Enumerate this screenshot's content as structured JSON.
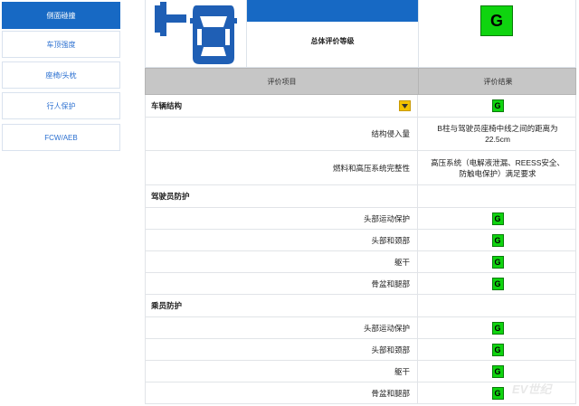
{
  "sidebar": {
    "items": [
      {
        "label": "侧面碰撞",
        "active": true
      },
      {
        "label": "车顶强度",
        "active": false
      },
      {
        "label": "座椅/头枕",
        "active": false
      },
      {
        "label": "行人保护",
        "active": false
      },
      {
        "label": "FCW/AEB",
        "active": false
      }
    ]
  },
  "hero": {
    "overall_label": "总体评价等级",
    "overall_rating": "G"
  },
  "table": {
    "header_item": "评价项目",
    "header_result": "评价结果"
  },
  "sections": {
    "vehicle": {
      "title": "车辆结构",
      "rating": "G",
      "rows": [
        {
          "label": "结构侵入量",
          "result": "B柱与驾驶员座椅中线之间的距离为22.5cm"
        },
        {
          "label": "燃料和高压系统完整性",
          "result": "高压系统（电解液泄漏、REESS安全、防触电保护）满足要求"
        }
      ]
    },
    "driver": {
      "title": "驾驶员防护",
      "rows": [
        {
          "label": "头部运动保护",
          "rating": "G"
        },
        {
          "label": "头部和颈部",
          "rating": "G"
        },
        {
          "label": "躯干",
          "rating": "G"
        },
        {
          "label": "骨盆和腿部",
          "rating": "G"
        }
      ]
    },
    "passenger": {
      "title": "乘员防护",
      "rows": [
        {
          "label": "头部运动保护",
          "rating": "G"
        },
        {
          "label": "头部和颈部",
          "rating": "G"
        },
        {
          "label": "躯干",
          "rating": "G"
        },
        {
          "label": "骨盆和腿部",
          "rating": "G"
        }
      ]
    }
  },
  "colors": {
    "accent": "#1769c4",
    "rating_good": "#0fd40f",
    "header_bg": "#c6c6c6",
    "toggle": "#f2c200"
  },
  "watermark": "EV世纪"
}
